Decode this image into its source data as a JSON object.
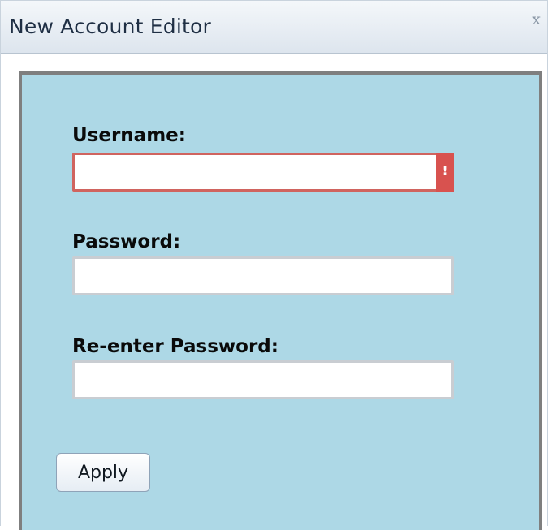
{
  "window": {
    "title": "New Account Editor",
    "close_glyph": "x"
  },
  "form": {
    "username": {
      "label": "Username:",
      "value": "",
      "state": "invalid",
      "error_indicator": "!"
    },
    "password": {
      "label": "Password:",
      "value": ""
    },
    "reenter_password": {
      "label": "Re-enter Password:",
      "value": ""
    },
    "apply_label": "Apply"
  },
  "colors": {
    "panel_background": "#add8e6",
    "panel_border": "#7f7f7f",
    "error_border": "#d0645f",
    "error_indicator": "#d8524f"
  }
}
